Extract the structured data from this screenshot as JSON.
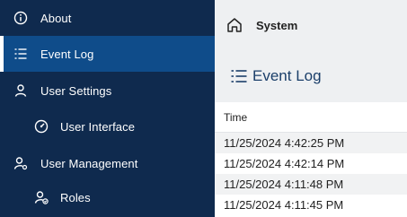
{
  "sidebar": {
    "items": [
      {
        "label": "About",
        "icon": "info-icon"
      },
      {
        "label": "Event Log",
        "icon": "list-icon"
      },
      {
        "label": "User Settings",
        "icon": "user-icon"
      },
      {
        "label": "User Interface",
        "icon": "dashboard-icon"
      },
      {
        "label": "User Management",
        "icon": "user-gear-icon"
      },
      {
        "label": "Roles",
        "icon": "user-check-icon"
      }
    ],
    "active_item": "Event Log"
  },
  "topbar": {
    "home_icon": "home-icon",
    "title": "System"
  },
  "page": {
    "title": "Event Log",
    "title_icon": "list-icon"
  },
  "table": {
    "columns": [
      "Time"
    ],
    "rows": [
      "11/25/2024 4:42:25 PM",
      "11/25/2024 4:42:14 PM",
      "11/25/2024 4:11:48 PM",
      "11/25/2024 4:11:45 PM"
    ]
  },
  "colors": {
    "sidebar_bg": "#0f2a4e",
    "sidebar_active_bg": "#0f4c8a",
    "title_color": "#1b3f6a"
  }
}
